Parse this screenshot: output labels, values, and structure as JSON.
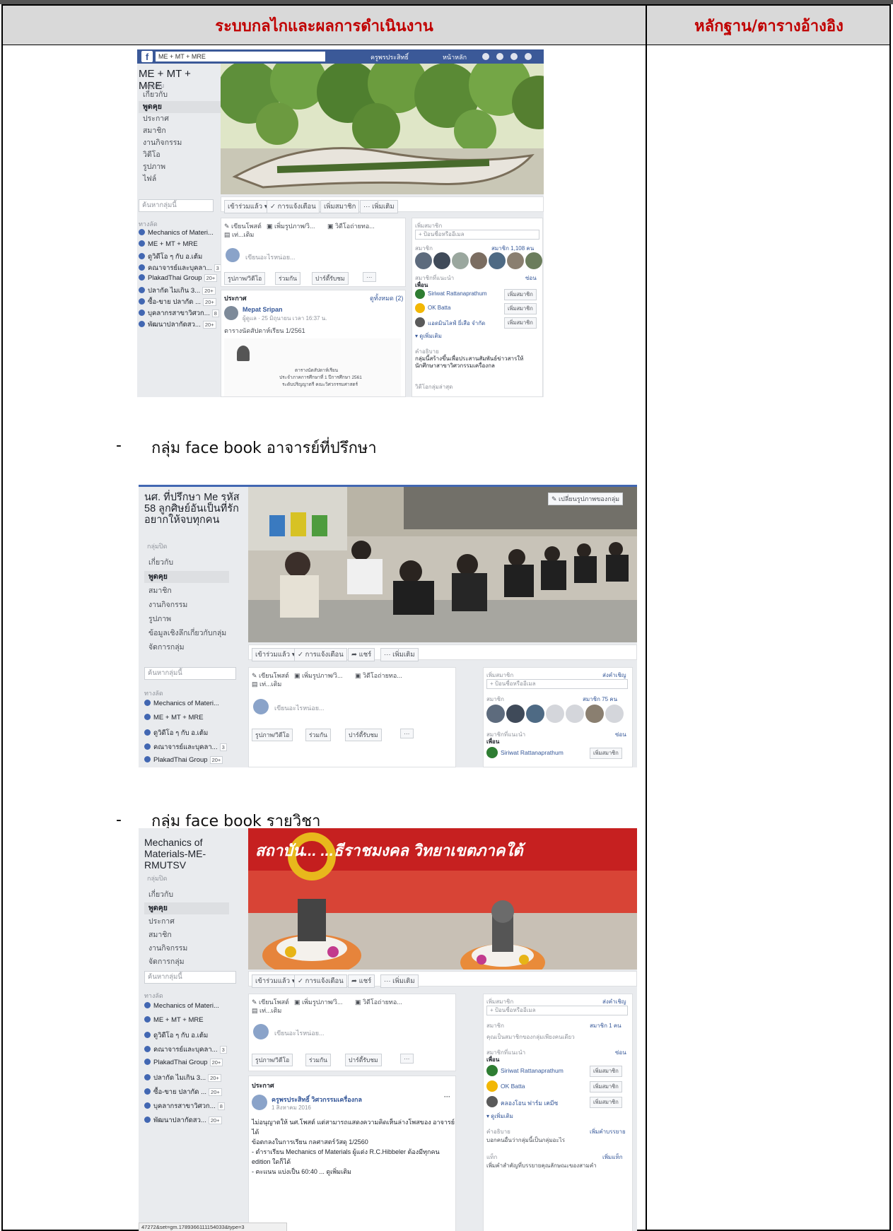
{
  "header": {
    "left_title": "ระบบกลไกและผลการดำเนินงาน",
    "right_title": "หลักฐาน/ตารางอ้างอิง"
  },
  "bullets": [
    {
      "dash": "-",
      "text": "กลุ่ม face book อาจารย์ที่ปรึกษา"
    },
    {
      "dash": "-",
      "text": "กลุ่ม face book รายวิชา"
    }
  ],
  "shot1": {
    "search": "ME + MT + MRE",
    "topbar_user": "ครูพรประสิทธิ์",
    "topbar_home": "หน้าหลัก",
    "group_name": "ME + MT + MRE",
    "group_type": "กลุ่มลับ",
    "nav": [
      "เกี่ยวกับ",
      "พูดคุย",
      "ประกาศ",
      "สมาชิก",
      "งานกิจกรรม",
      "วิดีโอ",
      "รูปภาพ",
      "ไฟล์"
    ],
    "group_search": "ค้นหากลุ่มนี้",
    "shortcuts_heading": "ทางลัด",
    "shortcuts": [
      {
        "label": "Mechanics of Materi...",
        "count": ""
      },
      {
        "label": "ME + MT + MRE",
        "count": ""
      },
      {
        "label": "ดูวิดีโอ ๆ กับ อ.เต้ม",
        "count": ""
      },
      {
        "label": "คณาจารย์และบุคลา...",
        "count": "3"
      },
      {
        "label": "PlakadThai Group",
        "count": "20+"
      },
      {
        "label": "ปลากัด ไมเกิน 3...",
        "count": "20+"
      },
      {
        "label": "ซื้อ-ขาย ปลากัด ...",
        "count": "20+"
      },
      {
        "label": "บุคลากรสาขาวิศวก...",
        "count": "8"
      },
      {
        "label": "พัฒนาปลากัดสว...",
        "count": "20+"
      }
    ],
    "actions": [
      "เข้าร่วมแล้ว ▾",
      "✓ การแจ้งเตือน",
      "เพิ่มสมาชิก",
      "··· เพิ่มเติม"
    ],
    "composer_tabs": [
      "✎ เขียนโพสต์",
      "▣ เพิ่มรูปภาพ/วิ...",
      "▣ วิดีโอถ่ายทอ...",
      "▤ เท่...เติม"
    ],
    "composer_placeholder": "เขียนอะไรหน่อย...",
    "composer_buttons": [
      "รูปภาพ/วิดีโอ",
      "ร่วมกัน",
      "ปาร์ตี้รับชม",
      "···"
    ],
    "announce_heading": "ประกาศ",
    "announce_seeall": "ดูทั้งหมด (2)",
    "post_author": "Mepat Sripan",
    "post_meta": "ผู้ดูแล · 25 มิถุนายน เวลา 16:37 น.",
    "post_text": "ตารางนัดสัปดาห์เรียน 1/2561",
    "doc_lines": [
      "ตารางนัดสัปดาห์เรียน",
      "ประจำภาคการศึกษาที่ 1 ปีการศึกษา 2561",
      "ระดับปริญญาตรี คณะวิศวกรรมศาสตร์"
    ],
    "right_add": "เพิ่มสมาชิก",
    "right_add_placeholder": "+ ป้อนชื่อหรืออีเมล",
    "right_members": "สมาชิก",
    "right_members_count": "สมาชิก 1,108 คน",
    "right_suggest": "สมาชิกที่แนะนำ",
    "right_hide": "ซ่อน",
    "right_friends": "เพื่อน",
    "suggest": [
      "Siriwat Rattanaprathum",
      "OK Batta",
      "แอดมินไลฟ์ ยี่เสือ จำกัด"
    ],
    "add_btn": "เพิ่มสมาชิก",
    "see_more": "▾ ดูเพิ่มเติม",
    "desc_label": "คำอธิบาย",
    "desc_text": "กลุ่มนี้สร้างขึ้นเพื่อประสานสัมพันธ์ข่าวสารให้นักศึกษาสาขาวิศวกรรมเครื่องกล",
    "tags_label": "วิดีโอกลุ่มล่าสุด"
  },
  "shot2": {
    "group_name": "นศ. ที่ปรึกษา Me รหัส 58 ลูกศิษย์อันเป็นที่รัก อยากให้จบทุกคน",
    "group_type": "กลุ่มปิด",
    "change_cover": "✎ เปลี่ยนรูปภาพของกลุ่ม",
    "nav": [
      "เกี่ยวกับ",
      "พูดคุย",
      "สมาชิก",
      "งานกิจกรรม",
      "รูปภาพ",
      "ข้อมูลเชิงลึกเกี่ยวกับกลุ่ม",
      "จัดการกลุ่ม"
    ],
    "group_search": "ค้นหากลุ่มนี้",
    "shortcuts_heading": "ทางลัด",
    "shortcuts": [
      {
        "label": "Mechanics of Materi...",
        "count": ""
      },
      {
        "label": "ME + MT + MRE",
        "count": ""
      },
      {
        "label": "ดูวิดีโอ ๆ กับ อ.เต้ม",
        "count": ""
      },
      {
        "label": "คณาจารย์และบุคลา...",
        "count": "3"
      },
      {
        "label": "PlakadThai Group",
        "count": "20+"
      }
    ],
    "actions": [
      "เข้าร่วมแล้ว ▾",
      "✓ การแจ้งเตือน",
      "➦ แชร์",
      "··· เพิ่มเติม"
    ],
    "composer_tabs": [
      "✎ เขียนโพสต์",
      "▣ เพิ่มรูปภาพ/วิ...",
      "▣ วิดีโอถ่ายทอ...",
      "▤ เท่...เติม"
    ],
    "composer_placeholder": "เขียนอะไรหน่อย...",
    "composer_buttons": [
      "รูปภาพ/วิดีโอ",
      "ร่วมกัน",
      "ปาร์ตี้รับชม",
      "···"
    ],
    "right_add": "เพิ่มสมาชิก",
    "right_invite": "ส่งคำเชิญ",
    "right_add_placeholder": "+ ป้อนชื่อหรืออีเมล",
    "right_members": "สมาชิก",
    "right_members_count": "สมาชิก 75 คน",
    "right_suggest": "สมาชิกที่แนะนำ",
    "right_hide": "ซ่อน",
    "right_friends": "เพื่อน",
    "suggest": [
      "Siriwat Rattanaprathum"
    ],
    "add_btn": "เพิ่มสมาชิก"
  },
  "shot3": {
    "group_name": "Mechanics of Materials-ME-RMUTSV",
    "group_type": "กลุ่มปิด",
    "cover_banner": "สถาบัน... ...ธีราชมงคล วิทยาเขตภาคใต้",
    "nav": [
      "เกี่ยวกับ",
      "พูดคุย",
      "ประกาศ",
      "สมาชิก",
      "งานกิจกรรม",
      "จัดการกลุ่ม"
    ],
    "group_search": "ค้นหากลุ่มนี้",
    "shortcuts_heading": "ทางลัด",
    "shortcuts": [
      {
        "label": "Mechanics of Materi...",
        "count": ""
      },
      {
        "label": "ME + MT + MRE",
        "count": ""
      },
      {
        "label": "ดูวิดีโอ ๆ กับ อ.เต้ม",
        "count": ""
      },
      {
        "label": "คณาจารย์และบุคลา...",
        "count": "3"
      },
      {
        "label": "PlakadThai Group",
        "count": "20+"
      },
      {
        "label": "ปลากัด ไมเกิน 3...",
        "count": "20+"
      },
      {
        "label": "ซื้อ-ขาย ปลากัด ...",
        "count": "20+"
      },
      {
        "label": "บุคลากรสาขาวิศวก...",
        "count": "8"
      },
      {
        "label": "พัฒนาปลากัดสว...",
        "count": "20+"
      }
    ],
    "actions": [
      "เข้าร่วมแล้ว ▾",
      "✓ การแจ้งเตือน",
      "➦ แชร์",
      "··· เพิ่มเติม"
    ],
    "composer_tabs": [
      "✎ เขียนโพสต์",
      "▣ เพิ่มรูปภาพ/วิ...",
      "▣ วิดีโอถ่ายทอ...",
      "▤ เท่...เติม"
    ],
    "composer_placeholder": "เขียนอะไรหน่อย...",
    "composer_buttons": [
      "รูปภาพ/วิดีโอ",
      "ร่วมกัน",
      "ปาร์ตี้รับชม",
      "···"
    ],
    "announce_heading": "ประกาศ",
    "post_author": "ครูพรประสิทธิ์ วิศวกรรมเครื่องกล",
    "post_meta": "1 สิงหาคม 2016",
    "post_lines": [
      "ไม่อนุญาตให้ นศ.โพสต์ แต่สามารถแสดงความคิดเห็นล่างโพสของ อาจารย์",
      "ได้",
      "ข้อตกลงในการเรียน กลศาสตร์วัสดุ 1/2560",
      "- ตำราเรียน Mechanics of Materials ผู้แต่ง R.C.Hibbeler ต้องมีทุกคน",
      "edition ใดก็ได้",
      "- คะแนน แบ่งเป็น 60:40 ... ดูเพิ่มเติม"
    ],
    "status_url": "47272&set=gm.1789366111154033&type=3",
    "right_add": "เพิ่มสมาชิก",
    "right_invite": "ส่งคำเชิญ",
    "right_add_placeholder": "+ ป้อนชื่อหรืออีเมล",
    "right_members": "สมาชิก",
    "right_members_count": "สมาชิก 1 คน",
    "right_only": "คุณเป็นสมาชิกของกลุ่มเพียงคนเดียว",
    "right_suggest": "สมาชิกที่แนะนำ",
    "right_hide": "ซ่อน",
    "right_friends": "เพื่อน",
    "suggest": [
      "Siriwat Rattanaprathum",
      "OK Batta",
      "คลองโอน ฟาร์ม เคมีซ"
    ],
    "add_btn": "เพิ่มสมาชิก",
    "see_more": "▾ ดูเพิ่มเติม",
    "desc_label": "คำอธิบาย",
    "desc_add": "เพิ่มคำบรรยาย",
    "desc_text": "บอกคนอื่นว่ากลุ่มนี้เป็นกลุ่มอะไร",
    "tags_label": "แท็ก",
    "tags_add": "เพิ่มแท็ก",
    "tags_text": "เพิ่มคำสำคัญที่บรรยายคุณลักษณะของสามคำ"
  }
}
